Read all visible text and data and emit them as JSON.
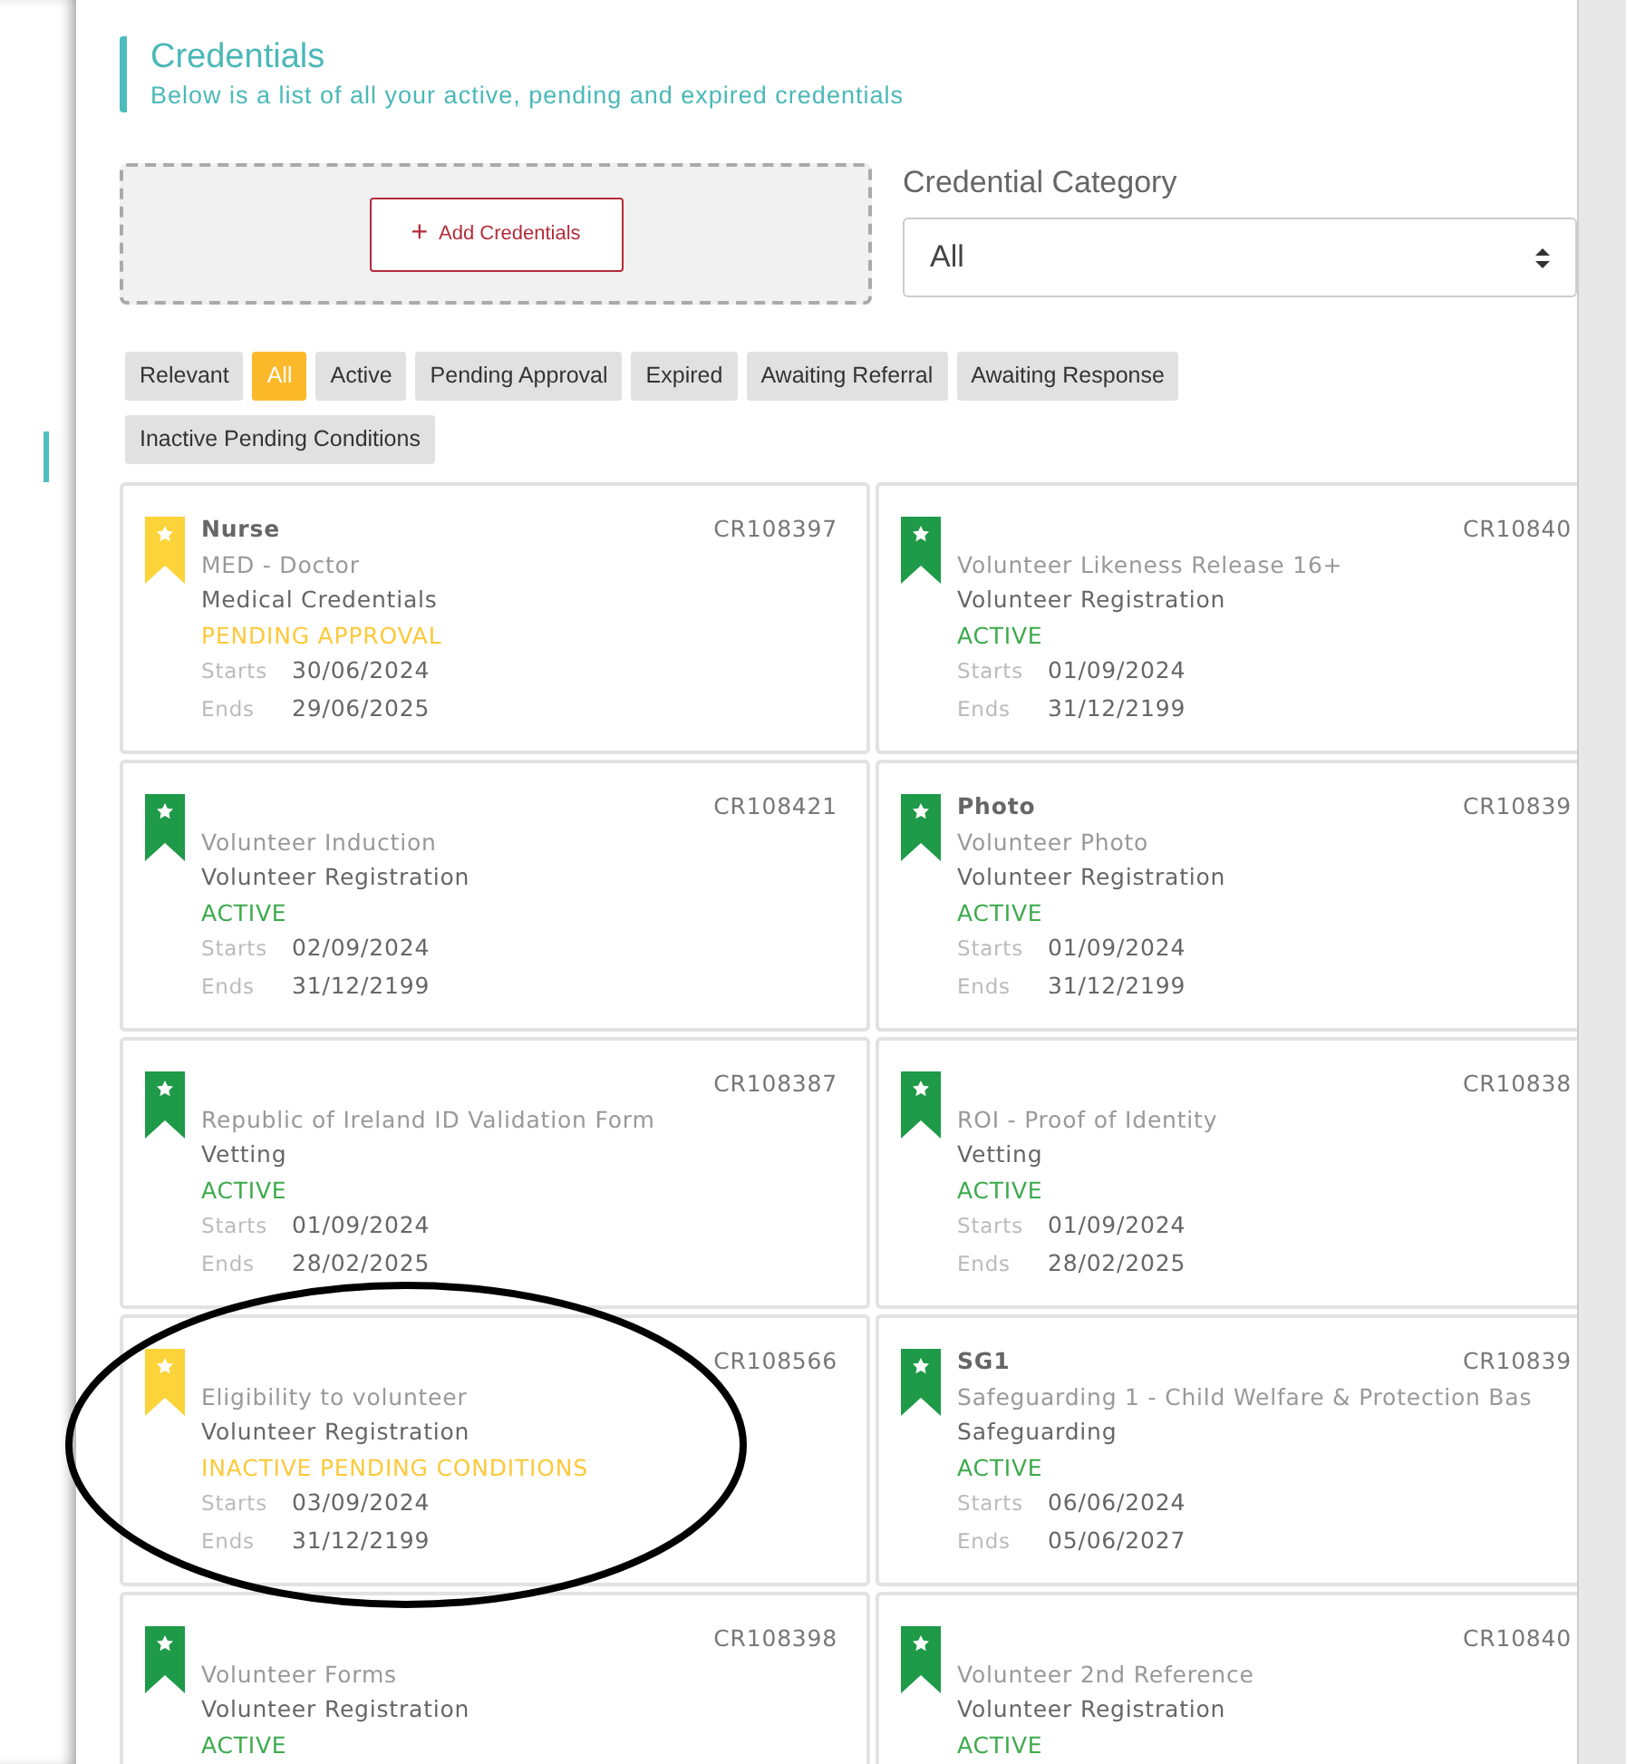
{
  "header": {
    "title": "Credentials",
    "subtitle": "Below is a list of all your active, pending and expired credentials"
  },
  "add_button": {
    "icon": "+",
    "label": "Add Credentials"
  },
  "category": {
    "label": "Credential Category",
    "value": "All"
  },
  "filters": [
    {
      "label": "Relevant",
      "selected": false
    },
    {
      "label": "All",
      "selected": true
    },
    {
      "label": "Active",
      "selected": false
    },
    {
      "label": "Pending Approval",
      "selected": false
    },
    {
      "label": "Expired",
      "selected": false
    },
    {
      "label": "Awaiting Referral",
      "selected": false
    },
    {
      "label": "Awaiting Response",
      "selected": false
    },
    {
      "label": "Inactive Pending Conditions",
      "selected": false
    }
  ],
  "credentials": [
    {
      "name": "Nurse",
      "id": "CR108397",
      "type": "MED - Doctor",
      "category": "Medical Credentials",
      "status": "PENDING APPROVAL",
      "kind": "pending",
      "starts_label": "Starts",
      "starts": "30/06/2024",
      "ends_label": "Ends",
      "ends": "29/06/2025"
    },
    {
      "id": "CR10840",
      "type": "Volunteer Likeness Release 16+",
      "category": "Volunteer Registration",
      "status": "ACTIVE",
      "kind": "active",
      "starts_label": "Starts",
      "starts": "01/09/2024",
      "ends_label": "Ends",
      "ends": "31/12/2199"
    },
    {
      "id": "CR108421",
      "type": "Volunteer Induction",
      "category": "Volunteer Registration",
      "status": "ACTIVE",
      "kind": "active",
      "starts_label": "Starts",
      "starts": "02/09/2024",
      "ends_label": "Ends",
      "ends": "31/12/2199"
    },
    {
      "name": "Photo",
      "id": "CR10839",
      "type": "Volunteer Photo",
      "category": "Volunteer Registration",
      "status": "ACTIVE",
      "kind": "active",
      "starts_label": "Starts",
      "starts": "01/09/2024",
      "ends_label": "Ends",
      "ends": "31/12/2199"
    },
    {
      "id": "CR108387",
      "type": "Republic of Ireland ID Validation Form",
      "category": "Vetting",
      "status": "ACTIVE",
      "kind": "active",
      "starts_label": "Starts",
      "starts": "01/09/2024",
      "ends_label": "Ends",
      "ends": "28/02/2025"
    },
    {
      "id": "CR10838",
      "type": "ROI - Proof of Identity",
      "category": "Vetting",
      "status": "ACTIVE",
      "kind": "active",
      "starts_label": "Starts",
      "starts": "01/09/2024",
      "ends_label": "Ends",
      "ends": "28/02/2025"
    },
    {
      "id": "CR108566",
      "type": "Eligibility to volunteer",
      "category": "Volunteer Registration",
      "status": "INACTIVE PENDING CONDITIONS",
      "kind": "pending",
      "starts_label": "Starts",
      "starts": "03/09/2024",
      "ends_label": "Ends",
      "ends": "31/12/2199"
    },
    {
      "name": "SG1",
      "id": "CR10839",
      "type": "Safeguarding 1 - Child Welfare & Protection Bas",
      "category": "Safeguarding",
      "status": "ACTIVE",
      "kind": "active",
      "starts_label": "Starts",
      "starts": "06/06/2024",
      "ends_label": "Ends",
      "ends": "05/06/2027"
    },
    {
      "id": "CR108398",
      "type": "Volunteer Forms",
      "category": "Volunteer Registration",
      "status": "ACTIVE",
      "kind": "active"
    },
    {
      "id": "CR10840",
      "type": "Volunteer 2nd Reference",
      "category": "Volunteer Registration",
      "status": "ACTIVE",
      "kind": "active"
    }
  ]
}
